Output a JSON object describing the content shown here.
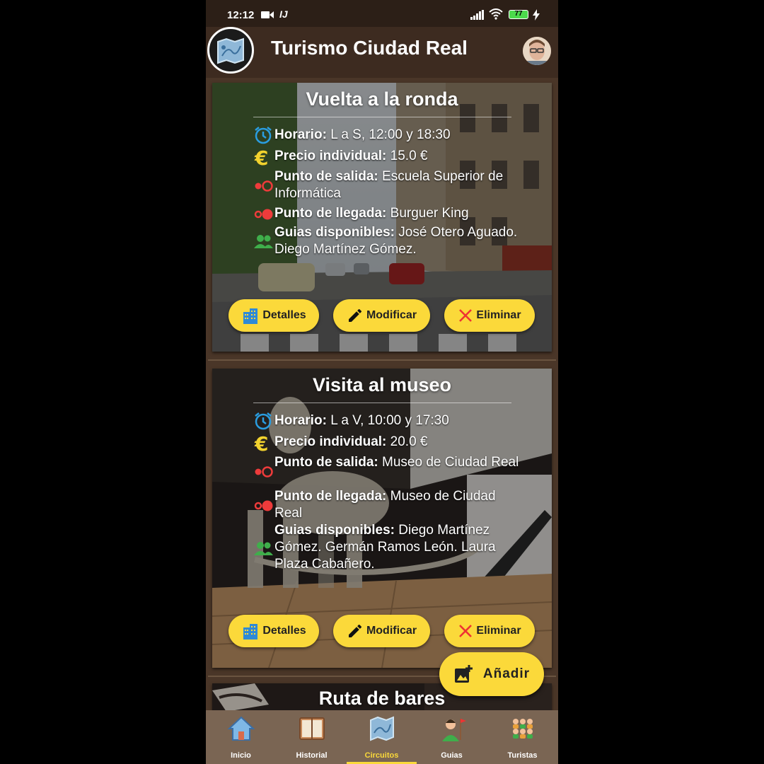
{
  "status_bar": {
    "time": "12:12",
    "battery": "77"
  },
  "app": {
    "title": "Turismo Ciudad Real"
  },
  "circuits": [
    {
      "title": "Vuelta a la ronda",
      "horario_label": "Horario:",
      "horario": "L a S, 12:00 y 18:30",
      "precio_label": "Precio individual:",
      "precio": "15.0 €",
      "salida_label": "Punto de salida:",
      "salida": "Escuela Superior de Informática",
      "llegada_label": "Punto de llegada:",
      "llegada": "Burguer King",
      "guias_label": "Guias disponibles:",
      "guias": "José Otero Aguado. Diego Martínez Gómez."
    },
    {
      "title": "Visita al museo",
      "horario_label": "Horario:",
      "horario": "L a V, 10:00 y 17:30",
      "precio_label": "Precio individual:",
      "precio": "20.0 €",
      "salida_label": "Punto de salida:",
      "salida": "Museo de Ciudad Real",
      "llegada_label": "Punto de llegada:",
      "llegada": "Museo de Ciudad Real",
      "guias_label": "Guias disponibles:",
      "guias": "Diego Martínez Gómez. Germán Ramos León. Laura Plaza Cabañero."
    },
    {
      "title": "Ruta de bares"
    }
  ],
  "buttons": {
    "details": "Detalles",
    "modify": "Modificar",
    "delete": "Eliminar"
  },
  "fab": {
    "label": "Añadir"
  },
  "nav": [
    {
      "label": "Inicio"
    },
    {
      "label": "Historial"
    },
    {
      "label": "Circuitos",
      "active": true
    },
    {
      "label": "Guias"
    },
    {
      "label": "Turistas"
    }
  ],
  "colors": {
    "accent": "#fbd93a",
    "header": "#3d2b20",
    "background": "#4a3628",
    "nav": "#7a6553"
  }
}
